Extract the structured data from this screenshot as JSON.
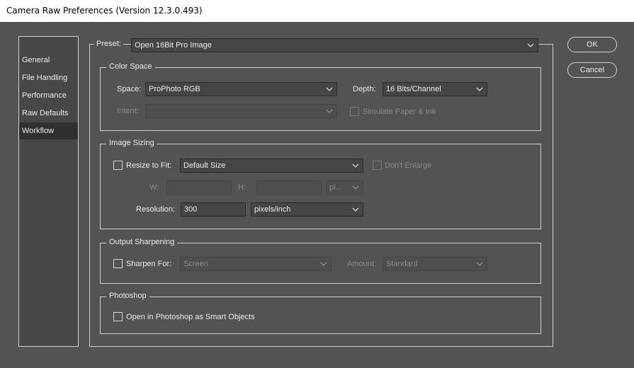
{
  "window": {
    "title": "Camera Raw Preferences  (Version 12.3.0.493)"
  },
  "sidebar": {
    "items": [
      {
        "label": "General"
      },
      {
        "label": "File Handling"
      },
      {
        "label": "Performance"
      },
      {
        "label": "Raw Defaults"
      },
      {
        "label": "Workflow",
        "selected": true
      }
    ]
  },
  "preset": {
    "label": "Preset:",
    "value": "Open 16Bit Pro Image"
  },
  "color_space": {
    "title": "Color Space",
    "space_label": "Space:",
    "space_value": "ProPhoto RGB",
    "depth_label": "Depth:",
    "depth_value": "16 Bits/Channel",
    "intent_label": "Intent:",
    "intent_value": "",
    "simulate_label": "Simulate Paper & Ink"
  },
  "image_sizing": {
    "title": "Image Sizing",
    "resize_label": "Resize to Fit:",
    "resize_value": "Default Size",
    "dont_enlarge_label": "Don't Enlarge",
    "w_label": "W:",
    "w_value": "",
    "h_label": "H:",
    "h_value": "",
    "unit_value": "pi...",
    "resolution_label": "Resolution:",
    "resolution_value": "300",
    "resolution_unit": "pixels/inch"
  },
  "output_sharpening": {
    "title": "Output Sharpening",
    "sharpen_label": "Sharpen For:",
    "sharpen_value": "Screen",
    "amount_label": "Amount:",
    "amount_value": "Standard"
  },
  "photoshop": {
    "title": "Photoshop",
    "smart_objects_label": "Open in Photoshop as Smart Objects"
  },
  "buttons": {
    "ok": "OK",
    "cancel": "Cancel"
  }
}
